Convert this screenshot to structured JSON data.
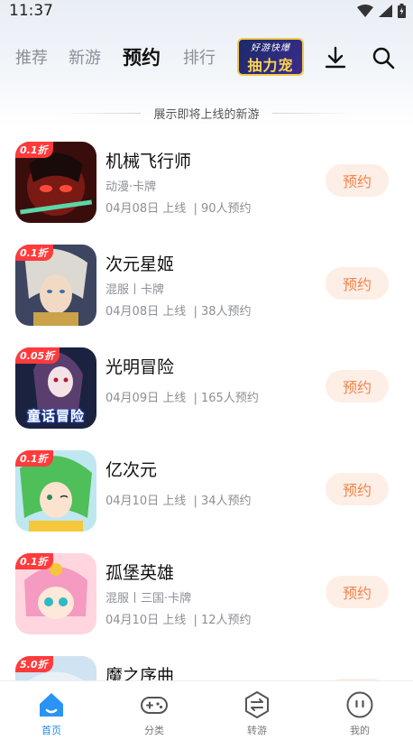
{
  "status_bar": {
    "time": "11:37",
    "icons": [
      "wifi-icon",
      "signal-icon",
      "battery-icon"
    ]
  },
  "nav": {
    "tabs": [
      {
        "label": "推荐",
        "active": false
      },
      {
        "label": "新游",
        "active": false
      },
      {
        "label": "预约",
        "active": true
      },
      {
        "label": "排行",
        "active": false
      }
    ],
    "logo_text_top": "好游快爆",
    "logo_text_main": "抽力宠",
    "icons": [
      "download-icon",
      "search-icon"
    ]
  },
  "subtitle": "展示即将上线的新游",
  "games": [
    {
      "name": "机械飞行师",
      "discount": "0.1折",
      "tags": "动漫·卡牌",
      "date": "04月08日 上线",
      "reservations": "90人预约",
      "button": "预约"
    },
    {
      "name": "次元星姬",
      "discount": "0.1折",
      "tags": "混服丨卡牌",
      "date": "04月08日 上线",
      "reservations": "38人预约",
      "button": "预约"
    },
    {
      "name": "光明冒险",
      "discount": "0.05折",
      "tags": "",
      "date": "04月09日 上线",
      "reservations": "165人预约",
      "button": "预约",
      "icon_caption": "童话冒险"
    },
    {
      "name": "亿次元",
      "discount": "0.1折",
      "tags": "",
      "date": "04月10日 上线",
      "reservations": "34人预约",
      "button": "预约"
    },
    {
      "name": "孤堡英雄",
      "discount": "0.1折",
      "tags": "混服丨三国·卡牌",
      "date": "04月10日 上线",
      "reservations": "12人预约",
      "button": "预约"
    },
    {
      "name": "魔之序曲",
      "discount": "5.0折",
      "tags": "",
      "date": "",
      "reservations": "",
      "button": "预约"
    }
  ],
  "bottom_nav": [
    {
      "label": "首页",
      "icon": "home-icon",
      "active": true
    },
    {
      "label": "分类",
      "icon": "gamepad-icon",
      "active": false
    },
    {
      "label": "转游",
      "icon": "transfer-icon",
      "active": false
    },
    {
      "label": "我的",
      "icon": "profile-icon",
      "active": false
    }
  ],
  "colors": {
    "accent": "#1f8af0",
    "reserve_bg": "#fdeee6",
    "reserve_text": "#f2844a",
    "discount_bg": "#ff3b3b"
  }
}
